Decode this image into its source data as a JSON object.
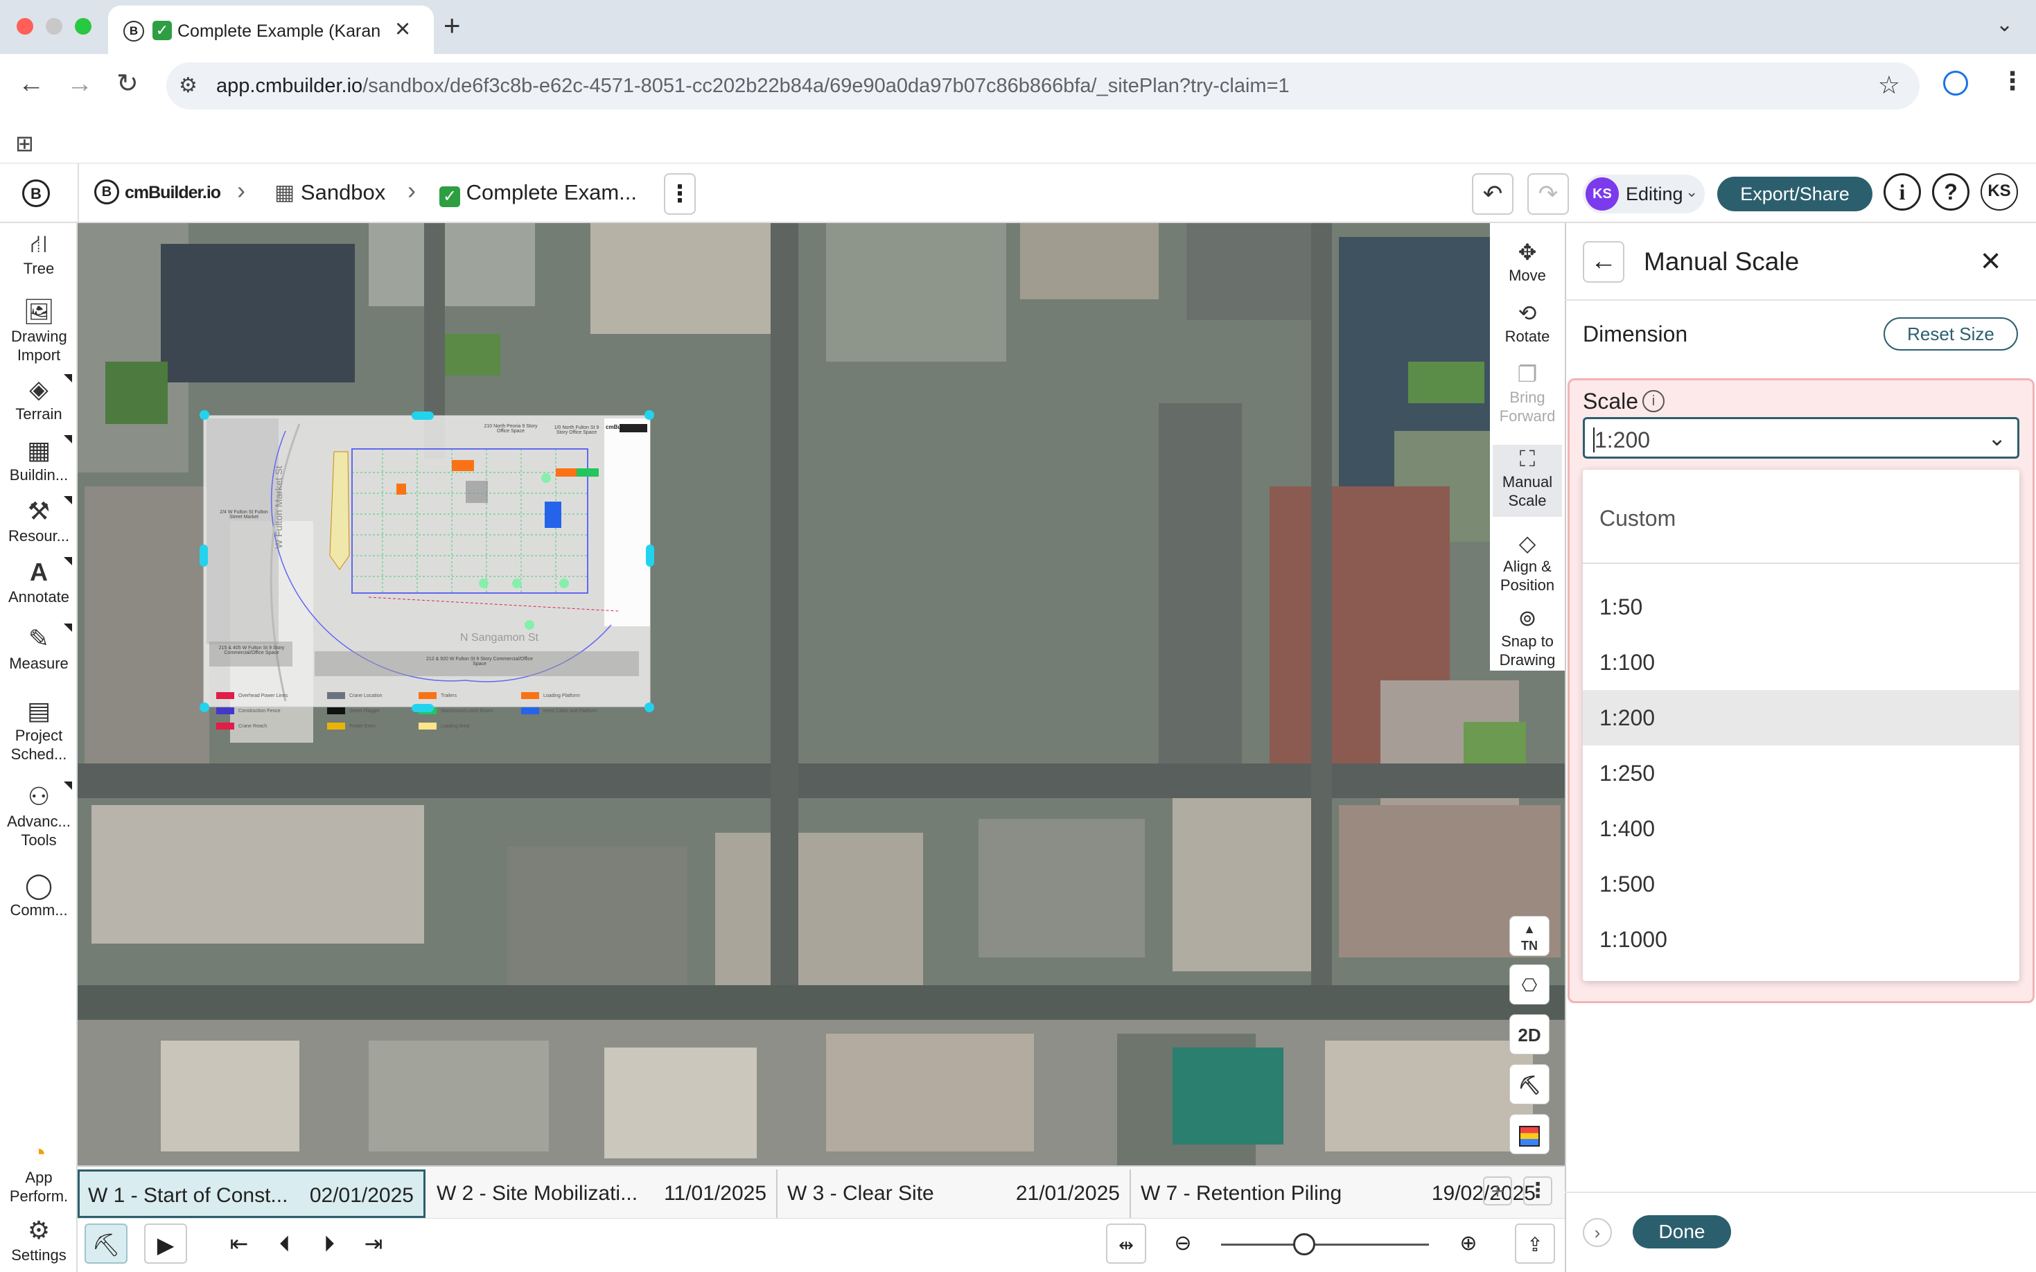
{
  "browser": {
    "tab_title": "Complete Example (Karan",
    "url_host": "app.cmbuilder.io",
    "url_path": "/sandbox/de6f3c8b-e62c-4571-8051-cc202b22b84a/69e90a0da97b07c86b866bfa/_sitePlan?try-claim=1"
  },
  "header": {
    "brand": "cmBuilder.io",
    "crumb1": "Sandbox",
    "crumb2": "Complete Exam...",
    "user_initials": "KS",
    "mode": "Editing",
    "export_label": "Export/Share",
    "info_label": "i",
    "help_label": "?",
    "account_initials": "KS"
  },
  "sidebar": {
    "items": [
      {
        "label": "Tree",
        "icon": "tree-icon"
      },
      {
        "label": "Drawing Import",
        "icon": "drawing-import-icon"
      },
      {
        "label": "Terrain",
        "icon": "terrain-icon"
      },
      {
        "label": "Buildin...",
        "icon": "building-icon"
      },
      {
        "label": "Resour...",
        "icon": "resources-icon"
      },
      {
        "label": "Annotate",
        "icon": "annotate-icon"
      },
      {
        "label": "Measure",
        "icon": "measure-icon"
      },
      {
        "label": "Project Sched...",
        "icon": "schedule-icon"
      },
      {
        "label": "Advanc... Tools",
        "icon": "tools-icon"
      },
      {
        "label": "Comm...",
        "icon": "comment-icon"
      },
      {
        "label": "App Perform.",
        "icon": "gauge-icon"
      },
      {
        "label": "Settings",
        "icon": "gear-icon"
      }
    ]
  },
  "map_tools": {
    "move": "Move",
    "rotate": "Rotate",
    "bring_forward": "Bring Forward",
    "manual_scale": "Manual Scale",
    "align_position": "Align & Position",
    "snap_drawing": "Snap to Drawing",
    "north": "TN",
    "view_2d": "2D"
  },
  "drawing": {
    "street_v": "W Fulton Market St",
    "street_h": "N Sangamon St",
    "label_tl": "2/4 W Fulton St Fulton Street Market",
    "label_top": "210 North Peoria 9 Story Office Space",
    "label_tr": "1/0 North Fulton St 9 Story Office Space",
    "label_bl": "215 & 405 W Fulton St 9 Story Commercial/Office Space",
    "label_bc": "212 & 920 W Fulton St 9 Story Commercial/Office Space",
    "logo": "cmBuilder.io",
    "legend": [
      {
        "label": "Overhead Power Lines",
        "color": "#e11d48"
      },
      {
        "label": "Crane Location",
        "color": "#6b7280"
      },
      {
        "label": "Trailers",
        "color": "#f97316"
      },
      {
        "label": "Loading Platform",
        "color": "#f97316"
      },
      {
        "label": "Construction Fence",
        "color": "#4338ca"
      },
      {
        "label": "Street Flagger",
        "color": "#111111"
      },
      {
        "label": "Washroom/Lunch Room",
        "color": "#22c55e"
      },
      {
        "label": "Hoist Cabin and Platform",
        "color": "#2563eb"
      },
      {
        "label": "Crane Reach",
        "color": "#e11d48"
      },
      {
        "label": "Power Entry",
        "color": "#eab308"
      },
      {
        "label": "Loading Area",
        "color": "#fde68a"
      }
    ]
  },
  "timeline": {
    "phases": [
      {
        "name": "W 1 - Start of Const...",
        "date": "02/01/2025"
      },
      {
        "name": "W 2 - Site Mobilizati...",
        "date": "11/01/2025"
      },
      {
        "name": "W 3 - Clear Site",
        "date": "21/01/2025"
      },
      {
        "name": "W 7 - Retention Piling",
        "date": "19/02/2025"
      }
    ],
    "zoom_level": 0.4
  },
  "panel": {
    "title": "Manual Scale",
    "dimension_label": "Dimension",
    "reset_label": "Reset Size",
    "scale_label": "Scale",
    "selected_scale": "1:200",
    "options": [
      "Custom",
      "1:50",
      "1:100",
      "1:200",
      "1:250",
      "1:400",
      "1:500",
      "1:1000"
    ],
    "done_label": "Done"
  },
  "colors": {
    "accent": "#2c5f6e",
    "handle": "#22d3ee",
    "highlight_bg": "#fde9e9"
  }
}
